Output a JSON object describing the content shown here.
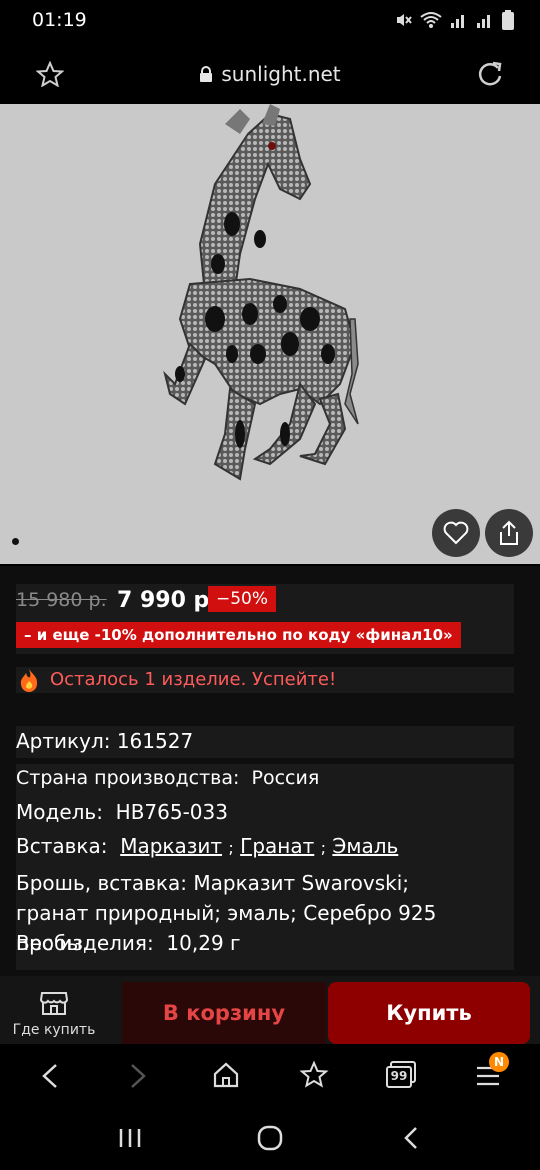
{
  "status": {
    "time": "01:19"
  },
  "browser": {
    "url": "sunlight.net"
  },
  "hero": {
    "image_alt": "giraffe brooch"
  },
  "pricing": {
    "old_price": "15 980 р.",
    "new_price": "7 990 р.",
    "discount": "−50%",
    "promo": "– и еще -10% дополнительно по коду «финал10»"
  },
  "stock": {
    "text": "Осталось 1 изделие. Успейте!"
  },
  "specs": {
    "article": "Артикул: 161527",
    "country_label": "Страна производства:",
    "country_value": "Россия",
    "model_label": "Модель:",
    "model_value": "НВ765-033",
    "insert_label": "Вставка:",
    "insert_links": [
      "Марказит",
      "Гранат",
      "Эмаль"
    ],
    "separator": ";",
    "description": "Брошь, вставка: Марказит Swarovski; гранат природный; эмаль; Серебро 925 пробы.",
    "weight_label": "Вес изделия:",
    "weight_value": "10,29 г"
  },
  "actions": {
    "where_to_buy": "Где купить",
    "add_to_cart": "В корзину",
    "buy": "Купить"
  },
  "toolbar": {
    "tabs_count": "99",
    "menu_badge": "N"
  },
  "colors": {
    "accent": "#d10f0f",
    "buy": "#8e0000",
    "stock": "#ff5b5b"
  }
}
